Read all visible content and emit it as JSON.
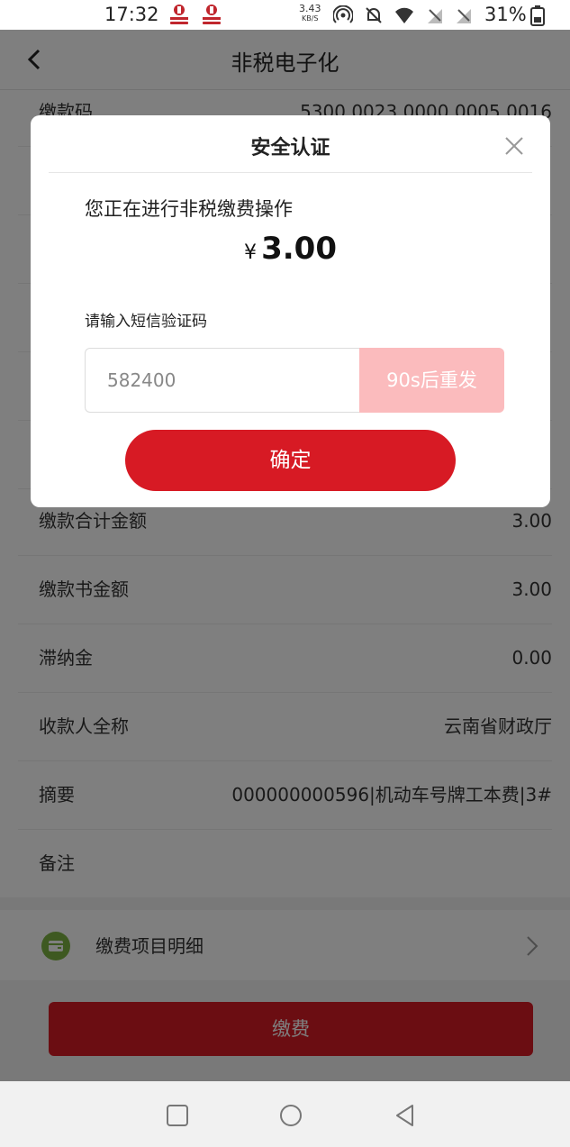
{
  "status_bar": {
    "time": "17:32",
    "net_speed_value": "3.43",
    "net_speed_unit": "KB/S",
    "battery": "31%",
    "icons": [
      "bank-app-icon",
      "bank-app-icon",
      "hotspot-icon",
      "mute-icon",
      "wifi-icon",
      "no-sim-icon",
      "no-sim-icon",
      "battery-icon"
    ]
  },
  "nav": {
    "title": "非税电子化",
    "back_icon": "chevron-left-icon"
  },
  "rows": [
    {
      "label": "缴款码",
      "value": "5300 0023 0000 0005 0016"
    },
    {
      "label": "",
      "value": ""
    },
    {
      "label": "",
      "value": ""
    },
    {
      "label": "",
      "value": ""
    },
    {
      "label": "",
      "value": ""
    },
    {
      "label": "",
      "value": ""
    },
    {
      "label": "缴款合计金额",
      "value": "3.00"
    },
    {
      "label": "缴款书金额",
      "value": "3.00"
    },
    {
      "label": "滞纳金",
      "value": "0.00"
    },
    {
      "label": "收款人全称",
      "value": "云南省财政厅"
    },
    {
      "label": "摘要",
      "value": "000000000596|机动车号牌工本费|3#"
    },
    {
      "label": "备注",
      "value": ""
    }
  ],
  "detail": {
    "label": "缴费项目明细",
    "icon": "wallet-icon",
    "chevron": "chevron-right-icon"
  },
  "pay_button": "缴费",
  "dialog": {
    "title": "安全认证",
    "close_icon": "close-icon",
    "message": "您正在进行非税缴费操作",
    "currency": "¥",
    "amount": "3.00",
    "sms_label": "请输入短信验证码",
    "sms_value": "582400",
    "resend_label": "90s后重发",
    "confirm_label": "确定"
  },
  "system_nav": [
    "square-icon",
    "circle-icon",
    "back-triangle-icon"
  ],
  "colors": {
    "brand_red": "#d71a24",
    "resend_disabled": "#fbbbbd",
    "overlay": "rgba(0,0,0,0.5)",
    "detail_icon_green": "#7cb342"
  }
}
